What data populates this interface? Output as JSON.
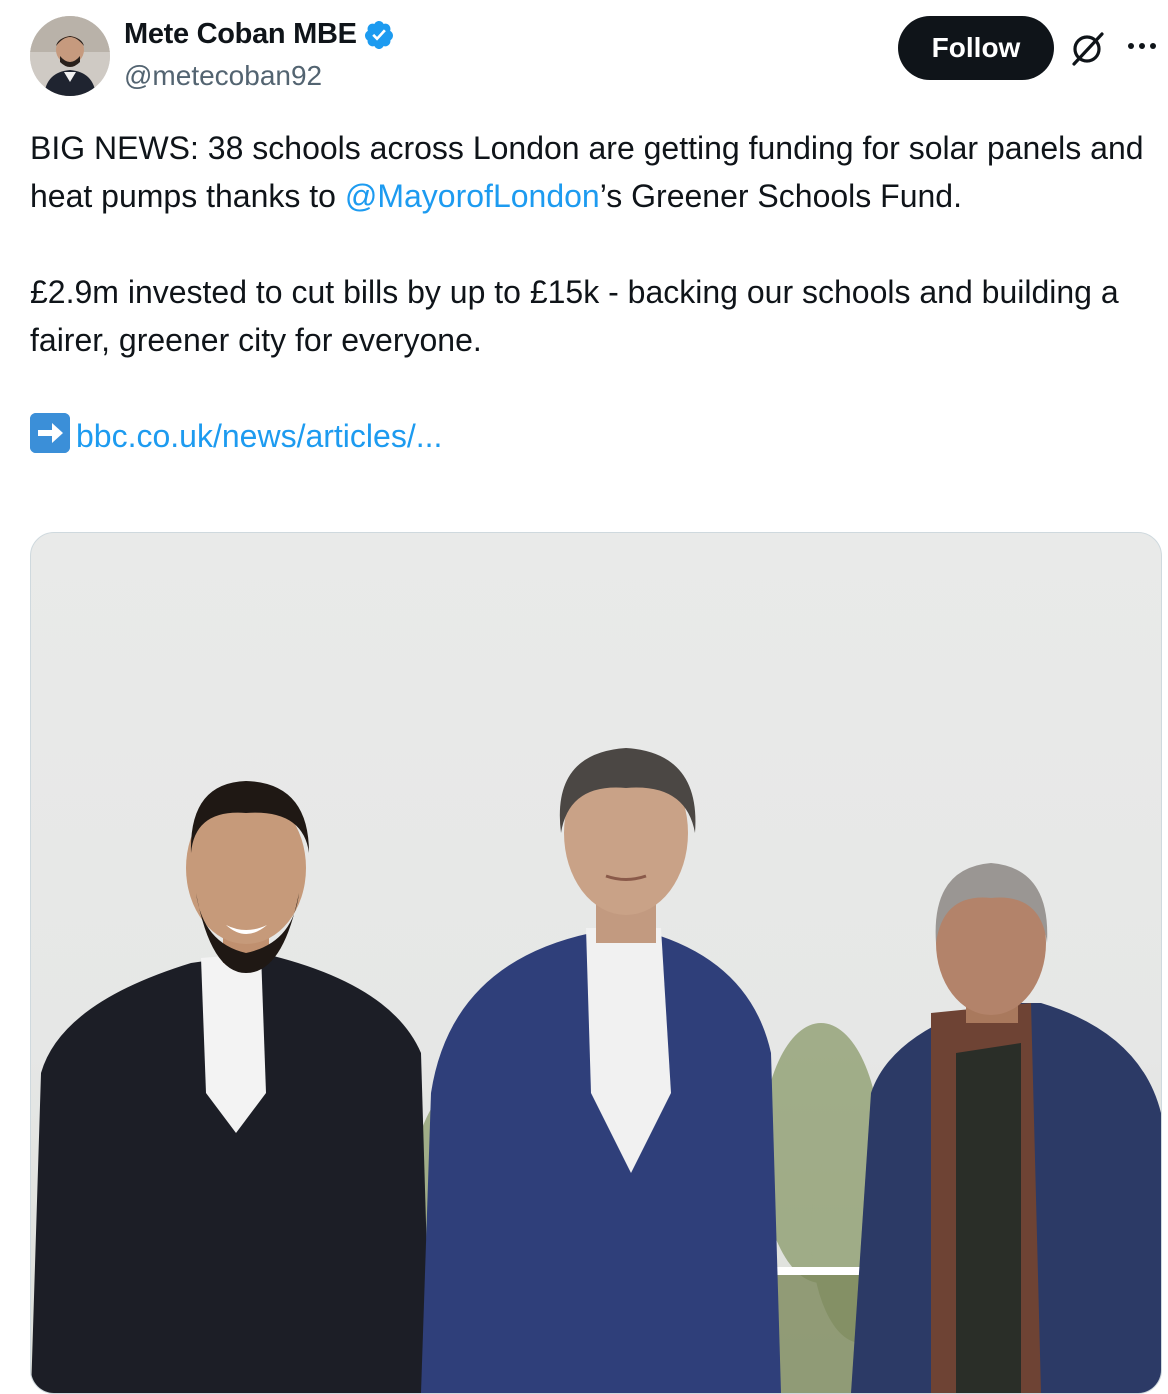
{
  "author": {
    "display_name": "Mete Coban MBE",
    "handle": "@metecoban92",
    "verified": true
  },
  "actions": {
    "follow_label": "Follow",
    "grok_icon": "grok-icon",
    "more_icon": "more-icon"
  },
  "tweet": {
    "line1_pre": "BIG NEWS: 38 schools across London are getting funding for solar panels and heat pumps thanks to ",
    "mention": "@MayorofLondon",
    "line1_post": "’s Greener Schools Fund.",
    "paragraph2": "£2.9m invested to cut bills by up to £15k - backing our schools and building a fairer, greener city for everyone.",
    "link_icon": "right-arrow-emoji-icon",
    "link_text": "bbc.co.uk/news/articles/..."
  },
  "colors": {
    "link": "#1d9bf0",
    "follow_bg": "#0f1419",
    "verified": "#1d9bf0",
    "muted": "#536471"
  }
}
